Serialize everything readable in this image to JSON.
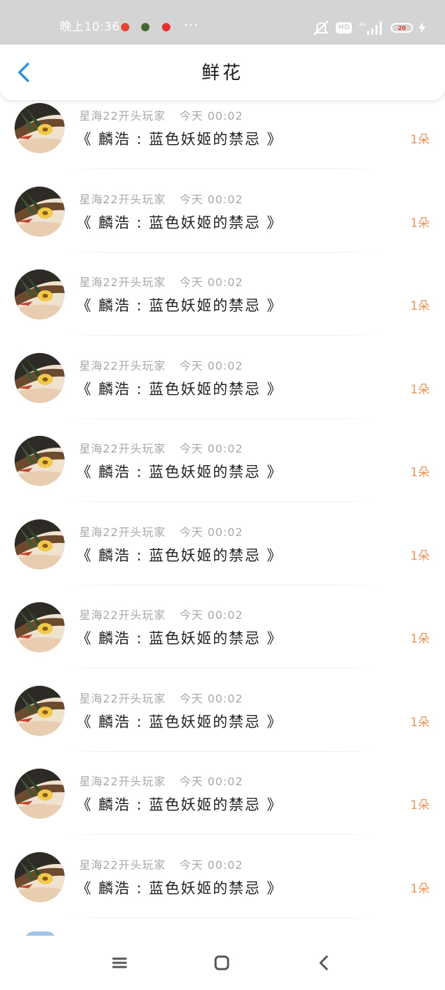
{
  "status_bar": {
    "time": "晚上10:36",
    "more": "···",
    "network": "4G",
    "hd": "HD",
    "battery_percent": 20,
    "battery_label": "20",
    "notification_icons": [
      "weibo-icon",
      "turtle-app-icon",
      "red-app-icon"
    ],
    "notification_colors": [
      "#e3432f",
      "#3f6b33",
      "#e8312a"
    ]
  },
  "header": {
    "title": "鲜花",
    "back_icon": "back-arrow-icon",
    "accent_color": "#2f8ee6"
  },
  "list": {
    "items": [
      {
        "user": "星海22开头玩家",
        "time": "今天 00:02",
        "title": "《 麟浩 : 蓝色妖姬的禁忌 》",
        "count": "1朵"
      },
      {
        "user": "星海22开头玩家",
        "time": "今天 00:02",
        "title": "《 麟浩 : 蓝色妖姬的禁忌 》",
        "count": "1朵"
      },
      {
        "user": "星海22开头玩家",
        "time": "今天 00:02",
        "title": "《 麟浩 : 蓝色妖姬的禁忌 》",
        "count": "1朵"
      },
      {
        "user": "星海22开头玩家",
        "time": "今天 00:02",
        "title": "《 麟浩 : 蓝色妖姬的禁忌 》",
        "count": "1朵"
      },
      {
        "user": "星海22开头玩家",
        "time": "今天 00:02",
        "title": "《 麟浩 : 蓝色妖姬的禁忌 》",
        "count": "1朵"
      },
      {
        "user": "星海22开头玩家",
        "time": "今天 00:02",
        "title": "《 麟浩 : 蓝色妖姬的禁忌 》",
        "count": "1朵"
      },
      {
        "user": "星海22开头玩家",
        "time": "今天 00:02",
        "title": "《 麟浩 : 蓝色妖姬的禁忌 》",
        "count": "1朵"
      },
      {
        "user": "星海22开头玩家",
        "time": "今天 00:02",
        "title": "《 麟浩 : 蓝色妖姬的禁忌 》",
        "count": "1朵"
      },
      {
        "user": "星海22开头玩家",
        "time": "今天 00:02",
        "title": "《 麟浩 : 蓝色妖姬的禁忌 》",
        "count": "1朵"
      },
      {
        "user": "星海22开头玩家",
        "time": "今天 00:02",
        "title": "《 麟浩 : 蓝色妖姬的禁忌 》",
        "count": "1朵"
      }
    ],
    "count_color": "#e8955a"
  },
  "nav_bar": {
    "buttons": [
      "menu-icon",
      "home-icon",
      "back-icon"
    ]
  }
}
